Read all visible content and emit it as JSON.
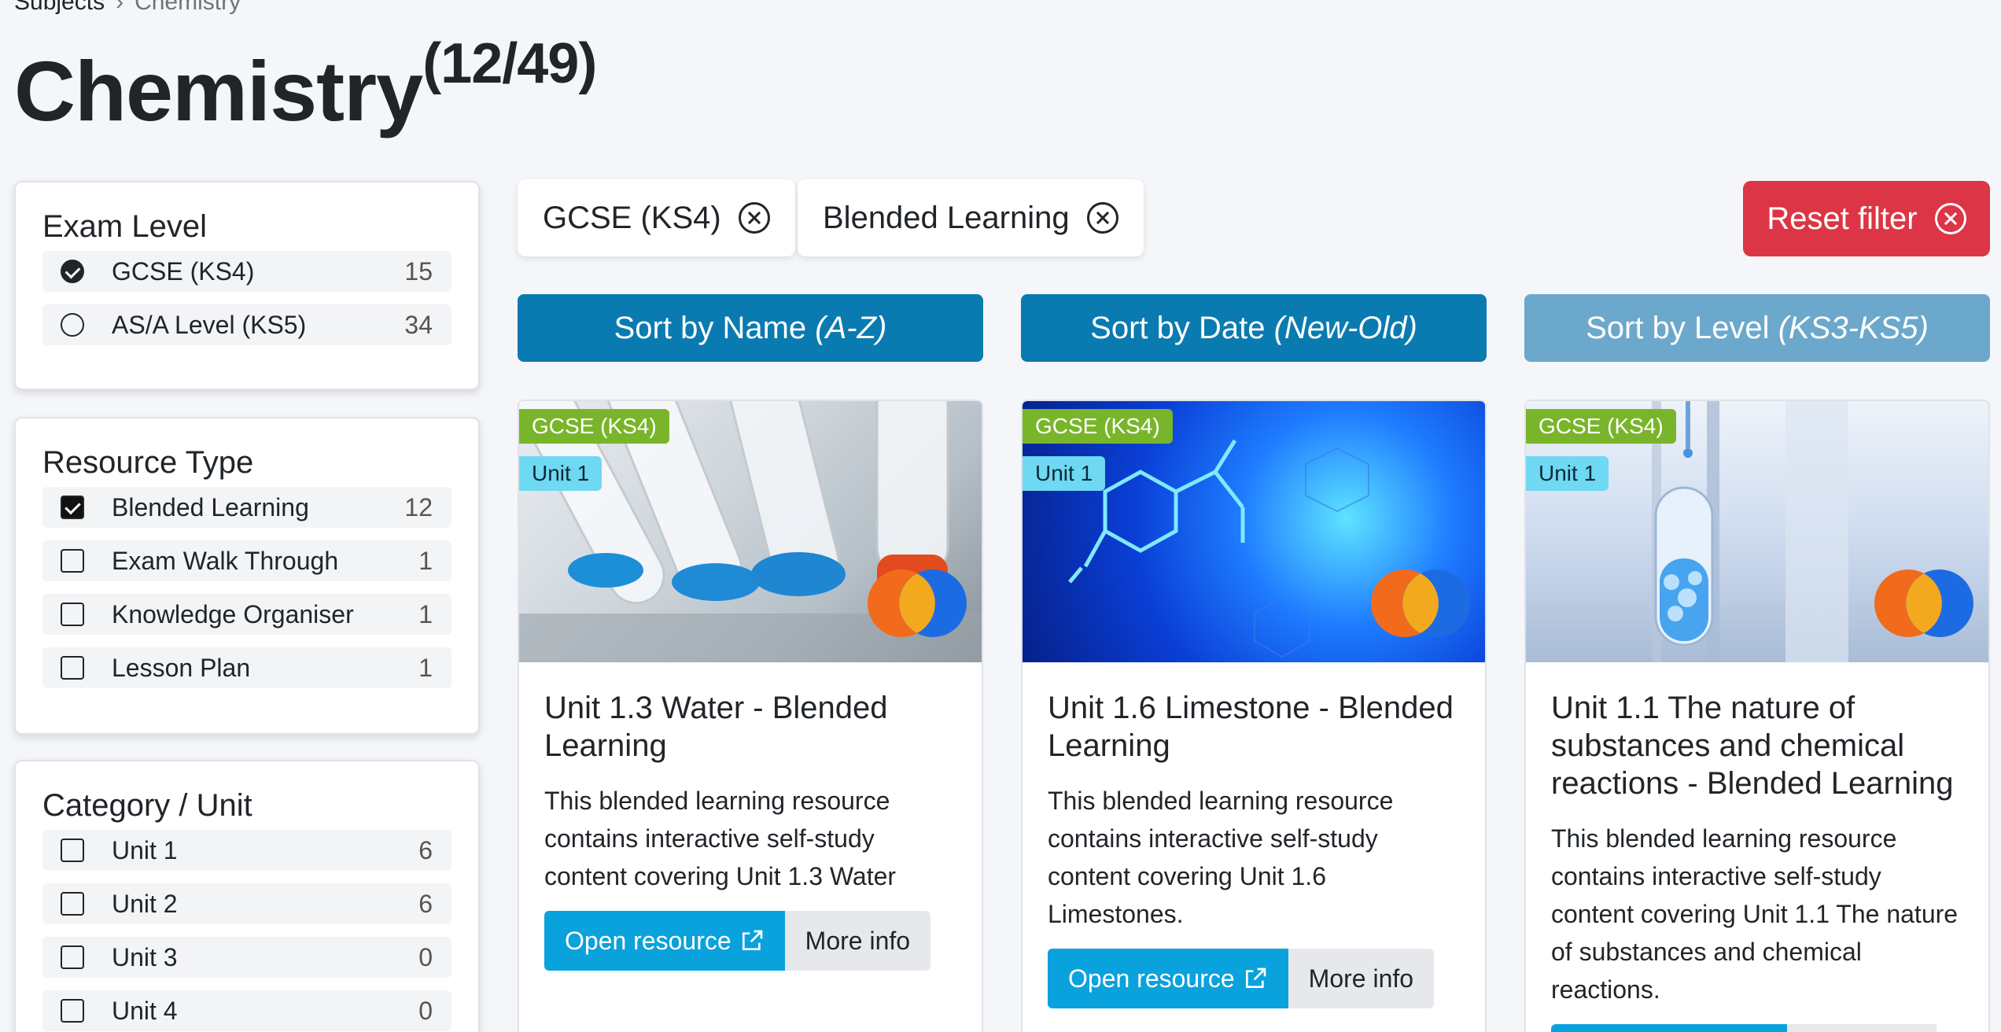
{
  "breadcrumb": {
    "parent": "Subjects",
    "separator": "›",
    "current": "Chemistry"
  },
  "page": {
    "title": "Chemistry",
    "count": "(12/49)"
  },
  "filters": {
    "exam_level": {
      "heading": "Exam Level",
      "options": [
        {
          "label": "GCSE (KS4)",
          "count": "15",
          "selected": true
        },
        {
          "label": "AS/A Level (KS5)",
          "count": "34",
          "selected": false
        }
      ]
    },
    "resource_type": {
      "heading": "Resource Type",
      "options": [
        {
          "label": "Blended Learning",
          "count": "12",
          "checked": true
        },
        {
          "label": "Exam Walk Through",
          "count": "1",
          "checked": false
        },
        {
          "label": "Knowledge Organiser",
          "count": "1",
          "checked": false
        },
        {
          "label": "Lesson Plan",
          "count": "1",
          "checked": false
        }
      ]
    },
    "category": {
      "heading": "Category / Unit",
      "options": [
        {
          "label": "Unit 1",
          "count": "6",
          "checked": false
        },
        {
          "label": "Unit 2",
          "count": "6",
          "checked": false
        },
        {
          "label": "Unit 3",
          "count": "0",
          "checked": false
        },
        {
          "label": "Unit 4",
          "count": "0",
          "checked": false
        }
      ]
    }
  },
  "active_filters": [
    {
      "label": "GCSE (KS4)"
    },
    {
      "label": "Blended Learning"
    }
  ],
  "reset_label": "Reset filter",
  "sort": [
    {
      "label": "Sort by Name",
      "hint": "(A-Z)"
    },
    {
      "label": "Sort by Date",
      "hint": "(New-Old)"
    },
    {
      "label": "Sort by Level",
      "hint": "(KS3-KS5)"
    }
  ],
  "cards": [
    {
      "level_tag": "GCSE (KS4)",
      "unit_tag": "Unit 1",
      "title": "Unit 1.3 Water - Blended Learning",
      "description": "This blended learning resource contains interactive self-study content covering Unit 1.3 Water",
      "open_label": "Open resource",
      "more_label": "More info"
    },
    {
      "level_tag": "GCSE (KS4)",
      "unit_tag": "Unit 1",
      "title": "Unit 1.6 Limestone - Blended Learning",
      "description": "This blended learning resource contains interactive self-study content covering Unit 1.6 Limestones.",
      "open_label": "Open resource",
      "more_label": "More info"
    },
    {
      "level_tag": "GCSE (KS4)",
      "unit_tag": "Unit 1",
      "title": "Unit 1.1 The nature of substances and chemical reactions - Blended Learning",
      "description": "This blended learning resource contains interactive self-study content covering Unit 1.1 The nature of substances and chemical reactions."
    }
  ],
  "colors": {
    "primary": "#0a7bb0",
    "danger": "#dc3545",
    "level_tag": "#79b52a",
    "unit_tag": "#6fd8f2",
    "open_button": "#0aa2dc"
  }
}
